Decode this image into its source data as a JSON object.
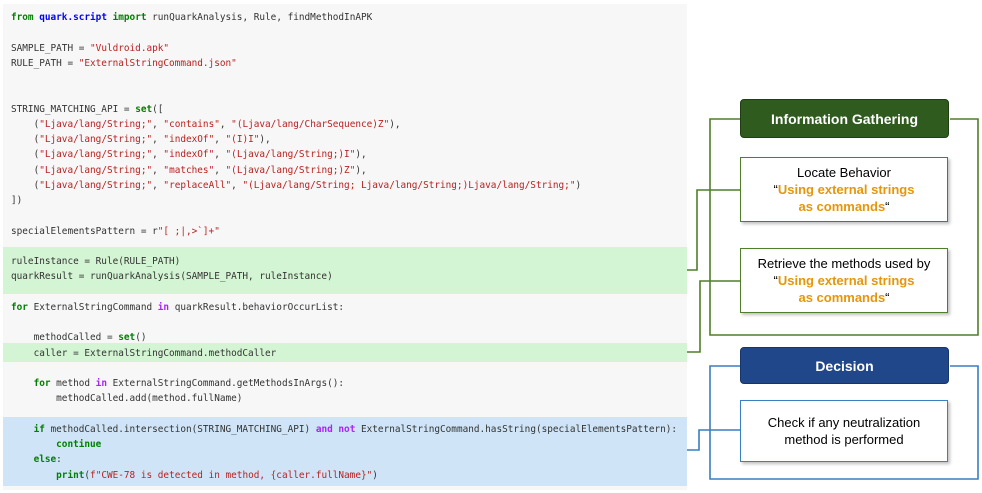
{
  "colors": {
    "code_background": "#f7f7f7",
    "highlight_green": "#d4f5d4",
    "highlight_blue": "#cfe5f7",
    "green_header": "#2f5b1e",
    "green_line": "#4f7f2a",
    "blue_header": "#20478a",
    "blue_line": "#3a7fc0",
    "accent_orange": "#e6960a"
  },
  "code": {
    "lines": [
      [
        {
          "t": "from",
          "c": "kw"
        },
        {
          "t": " ",
          "c": ""
        },
        {
          "t": "quark.script",
          "c": "mod"
        },
        {
          "t": " ",
          "c": ""
        },
        {
          "t": "import",
          "c": "kw"
        },
        {
          "t": " runQuarkAnalysis, Rule, findMethodInAPK",
          "c": ""
        }
      ],
      [],
      [
        {
          "t": "SAMPLE_PATH = ",
          "c": ""
        },
        {
          "t": "\"Vuldroid.apk\"",
          "c": "str"
        }
      ],
      [
        {
          "t": "RULE_PATH = ",
          "c": ""
        },
        {
          "t": "\"ExternalStringCommand.json\"",
          "c": "str"
        }
      ],
      [],
      [],
      [
        {
          "t": "STRING_MATCHING_API = ",
          "c": ""
        },
        {
          "t": "set",
          "c": "kw"
        },
        {
          "t": "([",
          "c": ""
        }
      ],
      [
        {
          "t": "    (",
          "c": ""
        },
        {
          "t": "\"Ljava/lang/String;\"",
          "c": "str"
        },
        {
          "t": ", ",
          "c": ""
        },
        {
          "t": "\"contains\"",
          "c": "str"
        },
        {
          "t": ", ",
          "c": ""
        },
        {
          "t": "\"(Ljava/lang/CharSequence)Z\"",
          "c": "str"
        },
        {
          "t": "),",
          "c": ""
        }
      ],
      [
        {
          "t": "    (",
          "c": ""
        },
        {
          "t": "\"Ljava/lang/String;\"",
          "c": "str"
        },
        {
          "t": ", ",
          "c": ""
        },
        {
          "t": "\"indexOf\"",
          "c": "str"
        },
        {
          "t": ", ",
          "c": ""
        },
        {
          "t": "\"(I)I\"",
          "c": "str"
        },
        {
          "t": "),",
          "c": ""
        }
      ],
      [
        {
          "t": "    (",
          "c": ""
        },
        {
          "t": "\"Ljava/lang/String;\"",
          "c": "str"
        },
        {
          "t": ", ",
          "c": ""
        },
        {
          "t": "\"indexOf\"",
          "c": "str"
        },
        {
          "t": ", ",
          "c": ""
        },
        {
          "t": "\"(Ljava/lang/String;)I\"",
          "c": "str"
        },
        {
          "t": "),",
          "c": ""
        }
      ],
      [
        {
          "t": "    (",
          "c": ""
        },
        {
          "t": "\"Ljava/lang/String;\"",
          "c": "str"
        },
        {
          "t": ", ",
          "c": ""
        },
        {
          "t": "\"matches\"",
          "c": "str"
        },
        {
          "t": ", ",
          "c": ""
        },
        {
          "t": "\"(Ljava/lang/String;)Z\"",
          "c": "str"
        },
        {
          "t": "),",
          "c": ""
        }
      ],
      [
        {
          "t": "    (",
          "c": ""
        },
        {
          "t": "\"Ljava/lang/String;\"",
          "c": "str"
        },
        {
          "t": ", ",
          "c": ""
        },
        {
          "t": "\"replaceAll\"",
          "c": "str"
        },
        {
          "t": ", ",
          "c": ""
        },
        {
          "t": "\"(Ljava/lang/String; Ljava/lang/String;)Ljava/lang/String;\"",
          "c": "str"
        },
        {
          "t": ")",
          "c": ""
        }
      ],
      [
        {
          "t": "])",
          "c": ""
        }
      ],
      [],
      [
        {
          "t": "specialElementsPattern = r",
          "c": ""
        },
        {
          "t": "\"[ ;|,>`]+\"",
          "c": "str"
        }
      ],
      [],
      [
        {
          "t": "ruleInstance = Rule(RULE_PATH)",
          "c": ""
        }
      ],
      [
        {
          "t": "quarkResult = runQuarkAnalysis(SAMPLE_PATH, ruleInstance)",
          "c": ""
        }
      ],
      [],
      [
        {
          "t": "for",
          "c": "kw"
        },
        {
          "t": " ExternalStringCommand ",
          "c": ""
        },
        {
          "t": "in",
          "c": "op"
        },
        {
          "t": " quarkResult.behaviorOccurList:",
          "c": ""
        }
      ],
      [],
      [
        {
          "t": "    methodCalled = ",
          "c": ""
        },
        {
          "t": "set",
          "c": "kw"
        },
        {
          "t": "()",
          "c": ""
        }
      ],
      [
        {
          "t": "    caller = ExternalStringCommand.methodCaller",
          "c": ""
        }
      ],
      [],
      [
        {
          "t": "    ",
          "c": ""
        },
        {
          "t": "for",
          "c": "kw"
        },
        {
          "t": " method ",
          "c": ""
        },
        {
          "t": "in",
          "c": "op"
        },
        {
          "t": " ExternalStringCommand.getMethodsInArgs():",
          "c": ""
        }
      ],
      [
        {
          "t": "        methodCalled.add(method.fullName)",
          "c": ""
        }
      ],
      [],
      [
        {
          "t": "    ",
          "c": ""
        },
        {
          "t": "if",
          "c": "kw"
        },
        {
          "t": " methodCalled.intersection(STRING_MATCHING_API) ",
          "c": ""
        },
        {
          "t": "and",
          "c": "op"
        },
        {
          "t": " ",
          "c": ""
        },
        {
          "t": "not",
          "c": "op"
        },
        {
          "t": " ExternalStringCommand.hasString(specialElementsPattern):",
          "c": ""
        }
      ],
      [
        {
          "t": "        ",
          "c": ""
        },
        {
          "t": "continue",
          "c": "kw"
        }
      ],
      [
        {
          "t": "    ",
          "c": ""
        },
        {
          "t": "else",
          "c": "kw"
        },
        {
          "t": ":",
          "c": ""
        }
      ],
      [
        {
          "t": "        ",
          "c": ""
        },
        {
          "t": "print",
          "c": "kw"
        },
        {
          "t": "(",
          "c": ""
        },
        {
          "t": "f\"CWE-78 is detected in method, {caller.fullName}\"",
          "c": "str"
        },
        {
          "t": ")",
          "c": ""
        }
      ]
    ]
  },
  "diagram": {
    "info_gathering": {
      "header": "Information Gathering",
      "locate": {
        "line1": "Locate Behavior",
        "open_quote": "“",
        "accent1": "Using external strings",
        "accent2": "as commands",
        "close_quote": "“"
      },
      "retrieve": {
        "line1": "Retrieve the methods used by",
        "open_quote": "“",
        "accent1": "Using external strings",
        "accent2": "as commands",
        "close_quote": "“"
      }
    },
    "decision": {
      "header": "Decision",
      "check": {
        "line1": "Check if any neutralization",
        "line2": "method is performed"
      }
    }
  }
}
